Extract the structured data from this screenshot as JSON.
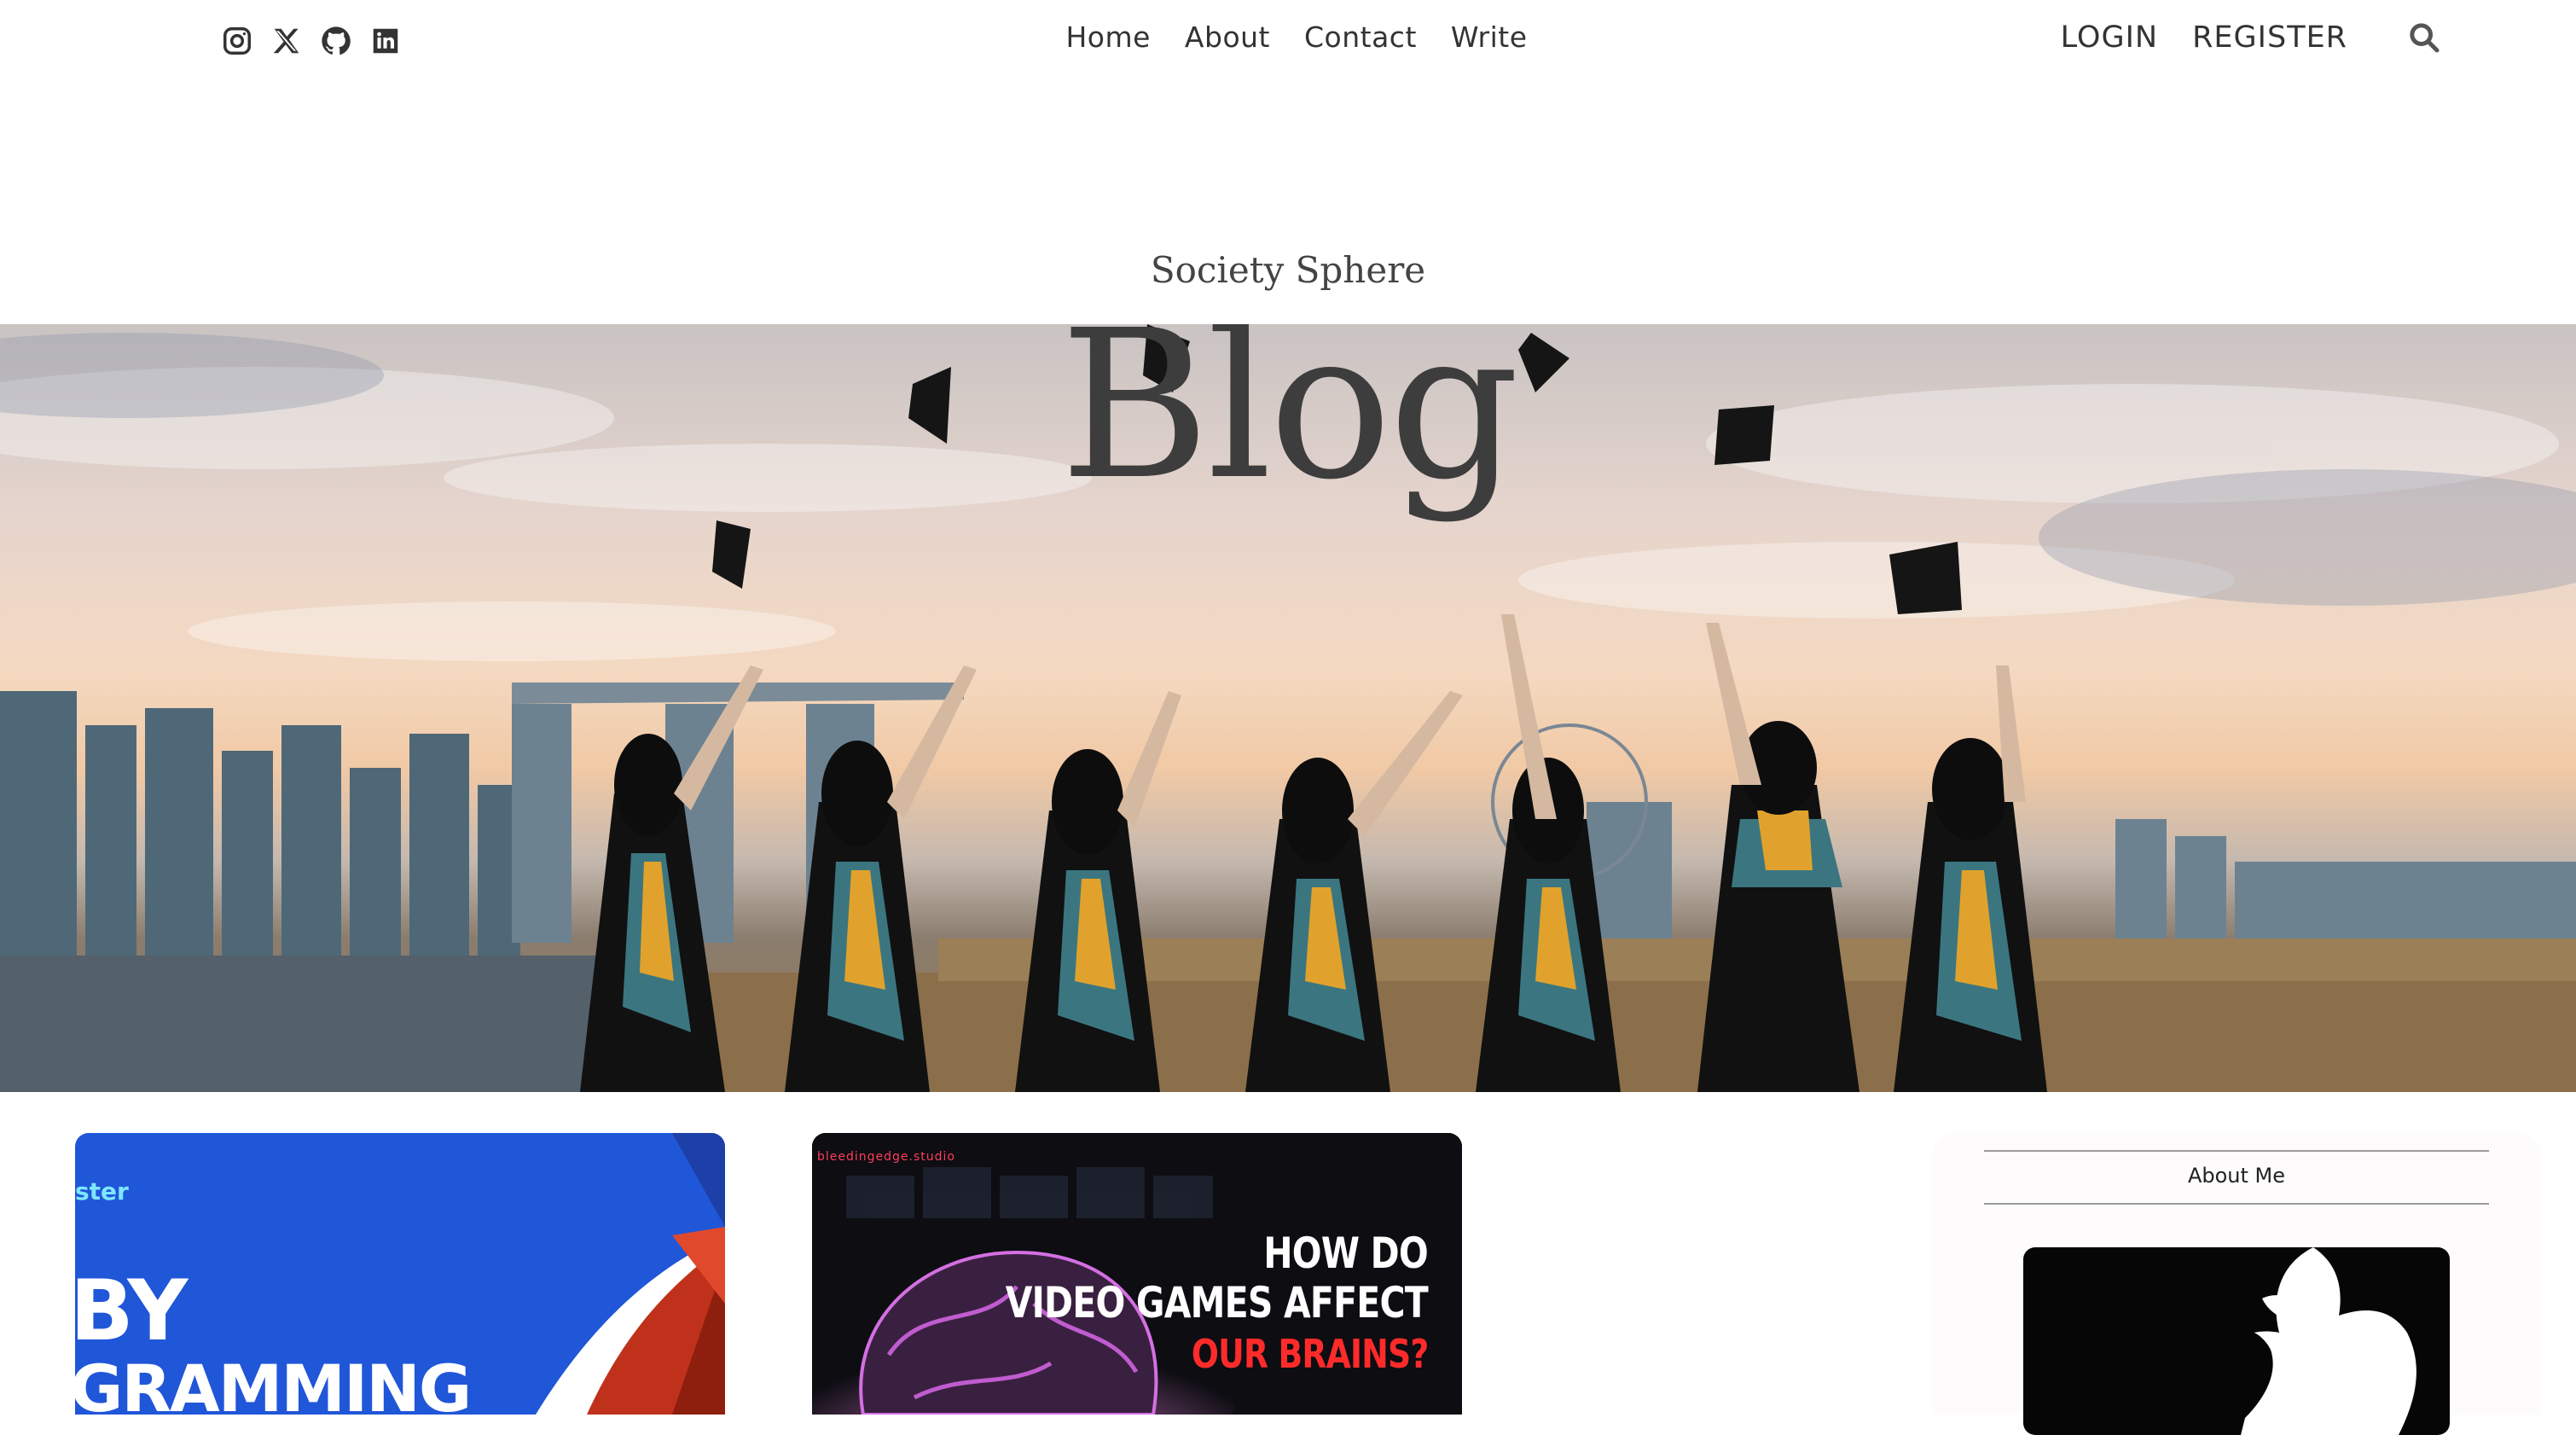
{
  "social": {
    "icons": [
      "instagram-icon",
      "x-twitter-icon",
      "github-icon",
      "linkedin-icon"
    ]
  },
  "nav": {
    "home": "Home",
    "about": "About",
    "contact": "Contact",
    "write": "Write"
  },
  "auth": {
    "login": "LOGIN",
    "register": "REGISTER",
    "search_icon": "search-icon"
  },
  "header": {
    "brand": "Society Sphere",
    "title": "Blog"
  },
  "posts": [
    {
      "tag": "ster",
      "line1": "BY",
      "line2": "GRAMMING"
    },
    {
      "tag": "bleedingedge.studio",
      "line1": "HOW DO",
      "line2": "VIDEO GAMES AFFECT",
      "line3": "OUR BRAINS?"
    }
  ],
  "sidebar": {
    "title": "About Me"
  },
  "colors": {
    "text": "#333333",
    "card_blue": "#2056d8",
    "card_dark": "#0d0d12",
    "accent_red": "#ff2b2b"
  }
}
